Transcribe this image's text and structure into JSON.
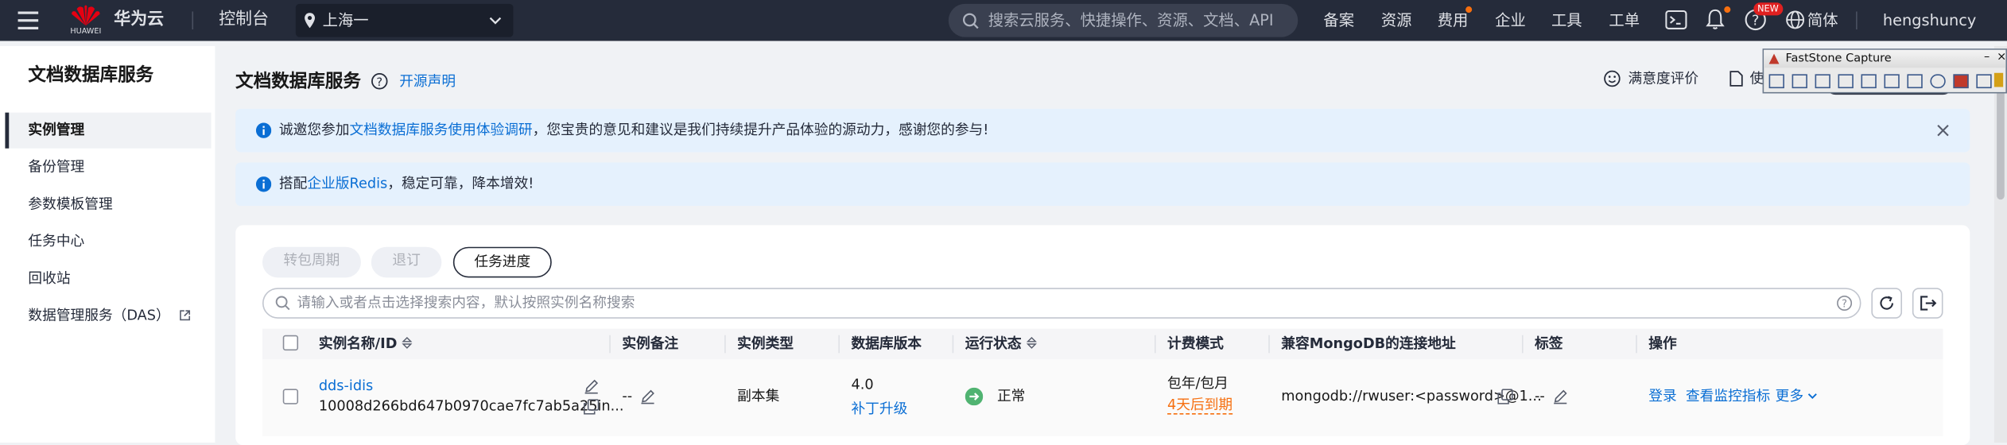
{
  "topbar": {
    "brand_name": "华为云",
    "brand_sub": "HUAWEI",
    "console": "控制台",
    "region": "上海一",
    "search_placeholder": "搜索云服务、快捷操作、资源、文档、API",
    "nav": [
      "备案",
      "资源",
      "费用",
      "企业",
      "工具",
      "工单"
    ],
    "new_badge": "NEW",
    "lang": "简体",
    "user": "hengshuncy"
  },
  "sidebar": {
    "title": "文档数据库服务",
    "items": [
      "实例管理",
      "备份管理",
      "参数模板管理",
      "任务中心",
      "回收站",
      "数据管理服务（DAS）"
    ]
  },
  "page": {
    "title": "文档数据库服务",
    "open_source": "开源声明",
    "satisfaction": "满意度评价",
    "right_cut": "使"
  },
  "notices": [
    {
      "prefix": "诚邀您参加",
      "link": "文档数据库服务使用体验调研",
      "suffix": "，您宝贵的意见和建议是我们持续提升产品体验的源动力，感谢您的参与!"
    },
    {
      "prefix": "搭配",
      "link": "企业版Redis",
      "suffix": "，稳定可靠，降本增效!"
    }
  ],
  "toolbar": {
    "convert": "转包周期",
    "unsubscribe": "退订",
    "task_progress": "任务进度"
  },
  "search": {
    "placeholder": "请输入或者点击选择搜索内容，默认按照实例名称搜索"
  },
  "table": {
    "headers": [
      "实例名称/ID",
      "实例备注",
      "实例类型",
      "数据库版本",
      "运行状态",
      "计费模式",
      "兼容MongoDB的连接地址",
      "标签",
      "操作"
    ],
    "row": {
      "name": "dds-idis",
      "id": "10008d266bd647b0970cae7fc7ab5a25in...",
      "remark": "--",
      "type": "副本集",
      "version": "4.0",
      "patch": "补丁升级",
      "status": "正常",
      "billing": "包年/包月",
      "expire": "4天后到期",
      "address": "mongodb://rwuser:<password>@1...",
      "tag": "--",
      "actions": [
        "登录",
        "查看监控指标",
        "更多"
      ]
    }
  },
  "faststone": {
    "title": "FastStone Capture"
  },
  "colors": {
    "topbar": "#252b3a",
    "link": "#0a6ed4",
    "notice_bg": "#e5f1fd",
    "status_ok": "#50b371",
    "warn": "#f66f0f"
  }
}
